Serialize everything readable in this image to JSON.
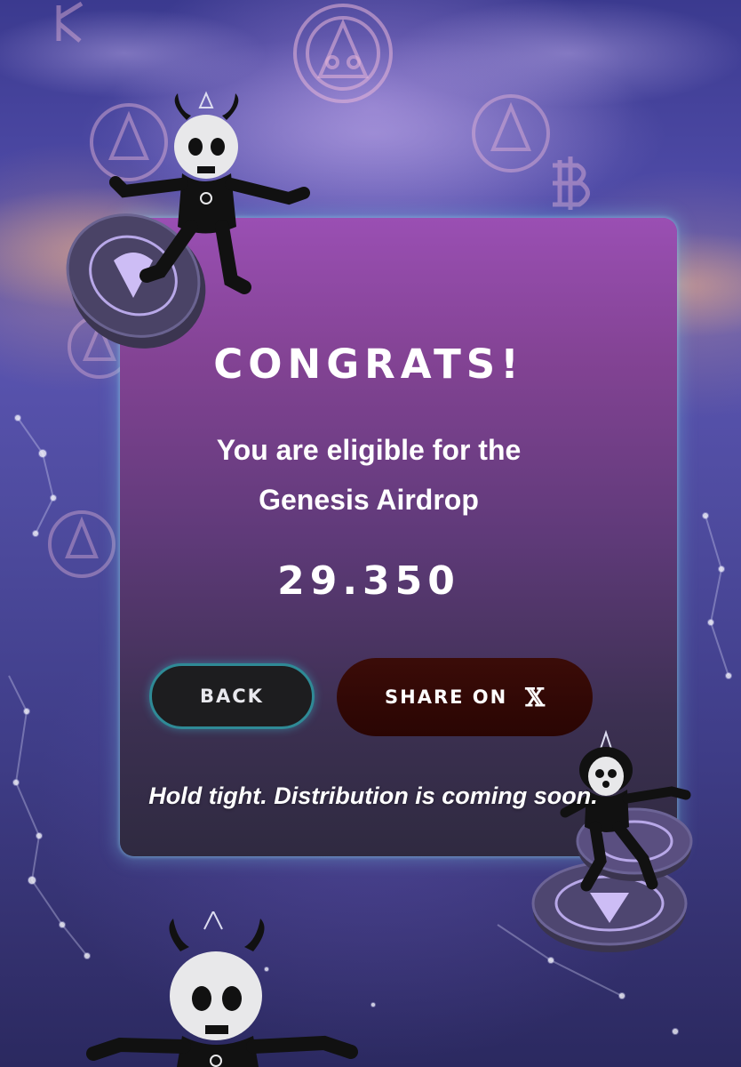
{
  "card": {
    "title": "CONGRATS!",
    "subtitle_line1": "You are eligible for the",
    "subtitle_line2": "Genesis Airdrop",
    "amount": "29.350",
    "note": "Hold tight. Distribution is coming soon."
  },
  "buttons": {
    "back_label": "BACK",
    "share_label": "SHARE ON",
    "share_icon": "x-logo-icon"
  },
  "colors": {
    "card_top": "#9a4fb3",
    "card_bottom": "#2f2a40",
    "back_border": "#2f8a96",
    "share_bg": "#3b0c08"
  }
}
